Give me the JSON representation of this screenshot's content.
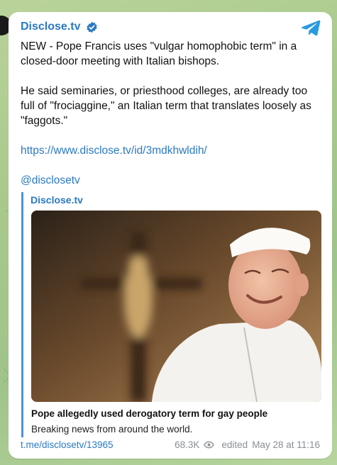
{
  "channel": {
    "name": "Disclose.tv"
  },
  "post": {
    "paragraph1": "NEW - Pope Francis uses \"vulgar homophobic term\" in a closed-door meeting with Italian bishops.",
    "paragraph2": "He said seminaries, or priesthood colleges, are already too full of \"frociaggine,\" an Italian term that translates loosely as \"faggots.\"",
    "link": "https://www.disclose.tv/id/3mdkhwldih/",
    "handle": "@disclosetv"
  },
  "preview": {
    "site": "Disclose.tv",
    "title": "Pope allegedly used derogatory term for gay people",
    "description": "Breaking news from around the world."
  },
  "footer": {
    "post_link": "t.me/disclosetv/13965",
    "views": "68.3K",
    "edited": "edited",
    "date": "May 28 at 11:16"
  },
  "colors": {
    "accent": "#2a79c4",
    "quote_bar": "#4d94d6",
    "meta": "#8a8f93"
  }
}
